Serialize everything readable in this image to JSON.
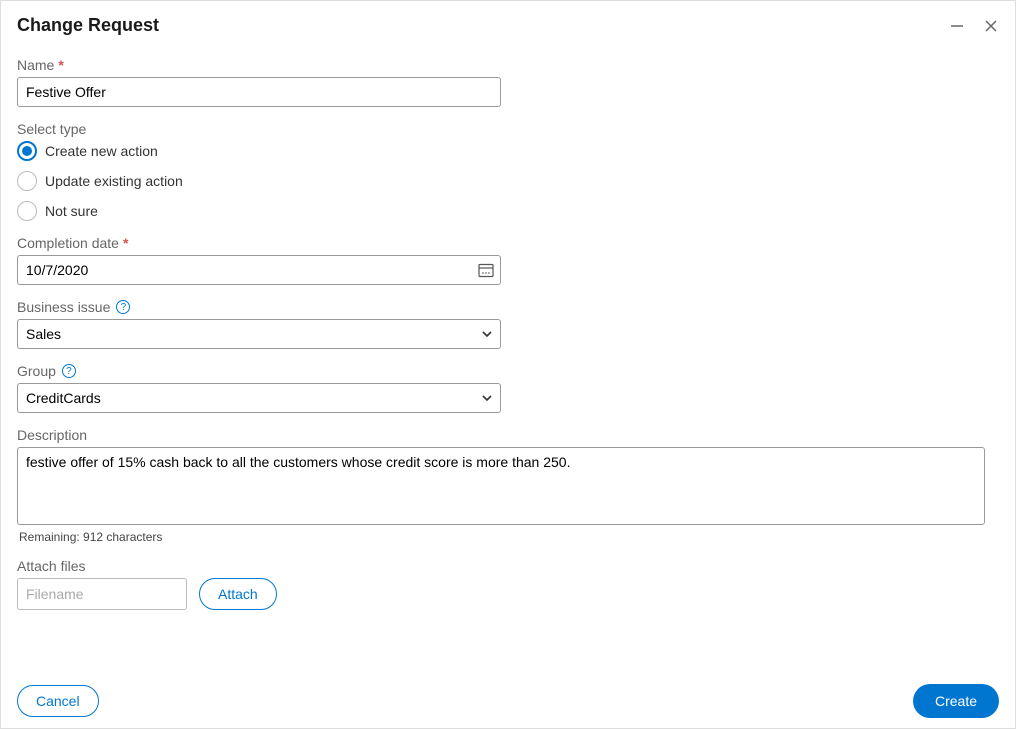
{
  "dialog": {
    "title": "Change Request"
  },
  "form": {
    "name_label": "Name",
    "name_value": "Festive Offer",
    "type_label": "Select type",
    "type_options": {
      "opt1": "Create new action",
      "opt2": "Update existing action",
      "opt3": "Not sure"
    },
    "type_selected": "opt1",
    "completion_label": "Completion date",
    "completion_value": "10/7/2020",
    "issue_label": "Business issue",
    "issue_value": "Sales",
    "group_label": "Group",
    "group_value": "CreditCards",
    "description_label": "Description",
    "description_value": "festive offer of 15% cash back to all the customers whose credit score is more than 250.",
    "remaining": "Remaining: 912 characters",
    "attach_label": "Attach files",
    "attach_placeholder": "Filename",
    "attach_button": "Attach"
  },
  "footer": {
    "cancel": "Cancel",
    "create": "Create"
  }
}
